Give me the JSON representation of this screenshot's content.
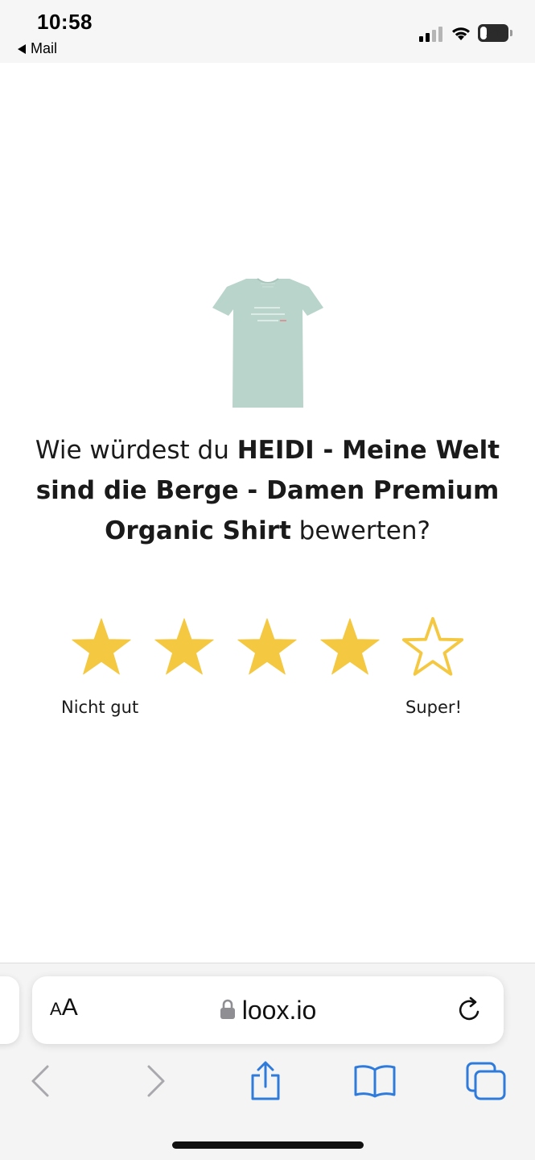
{
  "status_bar": {
    "time": "10:58",
    "back_app": "Mail",
    "battery_level": "26",
    "battery_fraction": 0.26,
    "icons": [
      "cellular-signal-icon",
      "wifi-icon",
      "battery-icon"
    ]
  },
  "product": {
    "image_icon": "tshirt-image",
    "shirt_color": "#b9d4cb"
  },
  "question": {
    "prefix": "Wie würdest du ",
    "product_name": "HEIDI - Meine Welt sind die Berge - Damen Premium Organic Shirt",
    "suffix": " bewerten?"
  },
  "rating": {
    "value": 4,
    "max": 5,
    "star_color": "#f5c842",
    "low_label": "Nicht gut",
    "high_label": "Super!"
  },
  "browser": {
    "text_size_button": {
      "small": "A",
      "large": "A"
    },
    "url": "loox.io",
    "toolbar_icons": [
      "back-icon",
      "forward-icon",
      "share-icon",
      "bookmarks-icon",
      "tabs-icon"
    ],
    "accent_color": "#2f7bdc",
    "disabled_color": "#a9a9ad"
  }
}
